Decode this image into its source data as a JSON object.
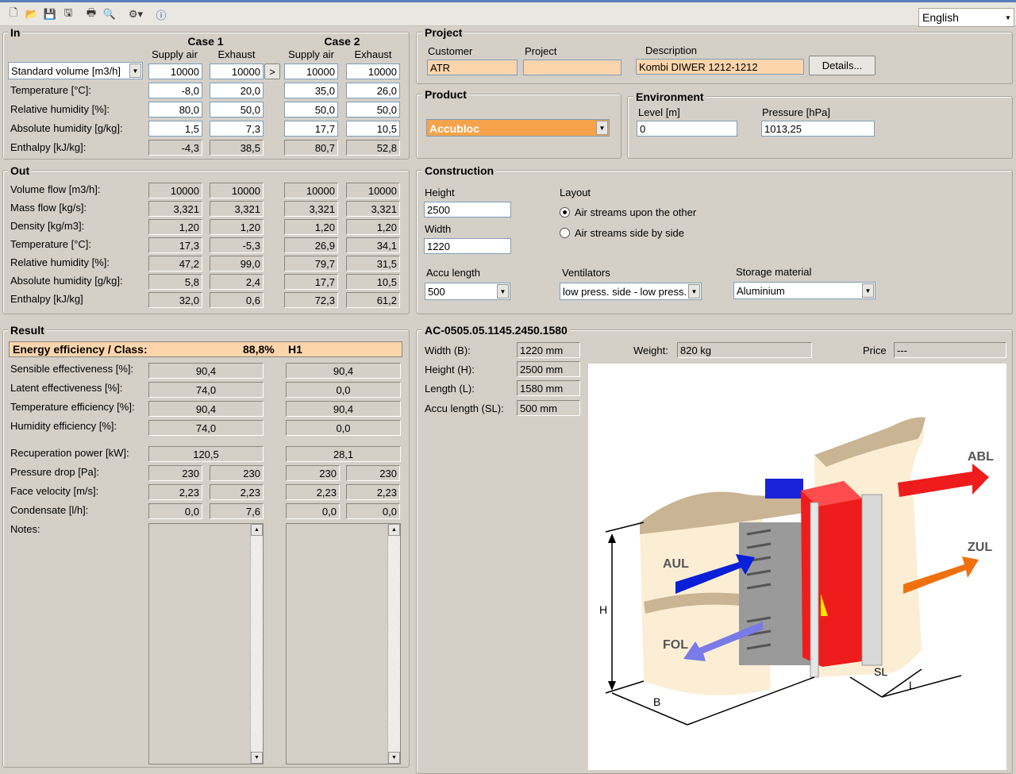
{
  "language": "English",
  "in": {
    "title": "In",
    "case1": "Case 1",
    "case2": "Case 2",
    "supply": "Supply air",
    "exhaust": "Exhaust",
    "volume_select": "Standard volume [m3/h]",
    "copy_btn": ">",
    "rows": [
      {
        "label": "",
        "vals": [
          "10000",
          "10000",
          "10000",
          "10000"
        ]
      },
      {
        "label": "Temperature [°C]:",
        "vals": [
          "-8,0",
          "20,0",
          "35,0",
          "26,0"
        ]
      },
      {
        "label": "Relative humidity [%]:",
        "vals": [
          "80,0",
          "50,0",
          "50,0",
          "50,0"
        ]
      },
      {
        "label": "Absolute humidity [g/kg]:",
        "vals": [
          "1,5",
          "7,3",
          "17,7",
          "10,5"
        ]
      },
      {
        "label": "Enthalpy [kJ/kg]:",
        "vals": [
          "-4,3",
          "38,5",
          "80,7",
          "52,8"
        ]
      }
    ]
  },
  "out": {
    "title": "Out",
    "rows": [
      {
        "label": "Volume flow [m3/h]:",
        "vals": [
          "10000",
          "10000",
          "10000",
          "10000"
        ]
      },
      {
        "label": "Mass flow [kg/s]:",
        "vals": [
          "3,321",
          "3,321",
          "3,321",
          "3,321"
        ]
      },
      {
        "label": "Density [kg/m3]:",
        "vals": [
          "1,20",
          "1,20",
          "1,20",
          "1,20"
        ]
      },
      {
        "label": "Temperature [°C]:",
        "vals": [
          "17,3",
          "-5,3",
          "26,9",
          "34,1"
        ]
      },
      {
        "label": "Relative humidity [%]:",
        "vals": [
          "47,2",
          "99,0",
          "79,7",
          "31,5"
        ]
      },
      {
        "label": "Absolute humidity [g/kg]:",
        "vals": [
          "5,8",
          "2,4",
          "17,7",
          "10,5"
        ]
      },
      {
        "label": "Enthalpy [kJ/kg]",
        "vals": [
          "32,0",
          "0,6",
          "72,3",
          "61,2"
        ]
      }
    ]
  },
  "result": {
    "title": "Result",
    "energy_label": "Energy efficiency / Class:",
    "energy_value": "88,8%",
    "energy_class": "H1",
    "eff_rows": [
      {
        "label": "Sensible effectiveness [%]:",
        "vals": [
          "90,4",
          "90,4"
        ]
      },
      {
        "label": "Latent effectiveness [%]:",
        "vals": [
          "74,0",
          "0,0"
        ]
      },
      {
        "label": "Temperature efficiency [%]:",
        "vals": [
          "90,4",
          "90,4"
        ]
      },
      {
        "label": "Humidity efficiency [%]:",
        "vals": [
          "74,0",
          "0,0"
        ]
      }
    ],
    "power": {
      "label": "Recuperation power [kW]:",
      "vals": [
        "120,5",
        "28,1"
      ]
    },
    "pairs": [
      {
        "label": "Pressure drop [Pa]:",
        "vals": [
          "230",
          "230",
          "230",
          "230"
        ]
      },
      {
        "label": "Face velocity [m/s]:",
        "vals": [
          "2,23",
          "2,23",
          "2,23",
          "2,23"
        ]
      },
      {
        "label": "Condensate [l/h]:",
        "vals": [
          "0,0",
          "7,6",
          "0,0",
          "0,0"
        ]
      }
    ],
    "notes_label": "Notes:"
  },
  "project": {
    "title": "Project",
    "customer_label": "Customer",
    "customer": "ATR",
    "project_label": "Project",
    "project": "",
    "description_label": "Description",
    "description": "Kombi DIWER 1212-1212",
    "details_btn": "Details..."
  },
  "product": {
    "title": "Product",
    "value": "Accubloc"
  },
  "environment": {
    "title": "Environment",
    "level_label": "Level [m]",
    "level": "0",
    "pressure_label": "Pressure [hPa]",
    "pressure": "1013,25"
  },
  "construction": {
    "title": "Construction",
    "height_label": "Height",
    "height": "2500",
    "width_label": "Width",
    "width": "1220",
    "layout_label": "Layout",
    "layout_opt1": "Air streams upon the other",
    "layout_opt2": "Air streams side by side",
    "accu_label": "Accu length",
    "accu": "500",
    "vent_label": "Ventilators",
    "vent": "low press. side - low press.",
    "storage_label": "Storage material",
    "storage": "Aluminium"
  },
  "model": {
    "title": "AC-0505.05.1145.2450.1580",
    "width_label": "Width (B):",
    "width": "1220 mm",
    "height_label": "Height (H):",
    "height": "2500 mm",
    "length_label": "Length (L):",
    "length": "1580 mm",
    "accu_label": "Accu length (SL):",
    "accu": "500 mm",
    "weight_label": "Weight:",
    "weight": "820 kg",
    "price_label": "Price",
    "price": "---",
    "diagram": {
      "abl": "ABL",
      "zul": "ZUL",
      "aul": "AUL",
      "fol": "FOL",
      "h": "H",
      "b": "B",
      "sl": "SL",
      "l": "L"
    }
  },
  "colors": {
    "peach": "#fcd5ac",
    "product": "#f5a34b",
    "supply": "#0a1fd8",
    "exhaust": "#ee1c1c",
    "orange": "#f07010"
  }
}
